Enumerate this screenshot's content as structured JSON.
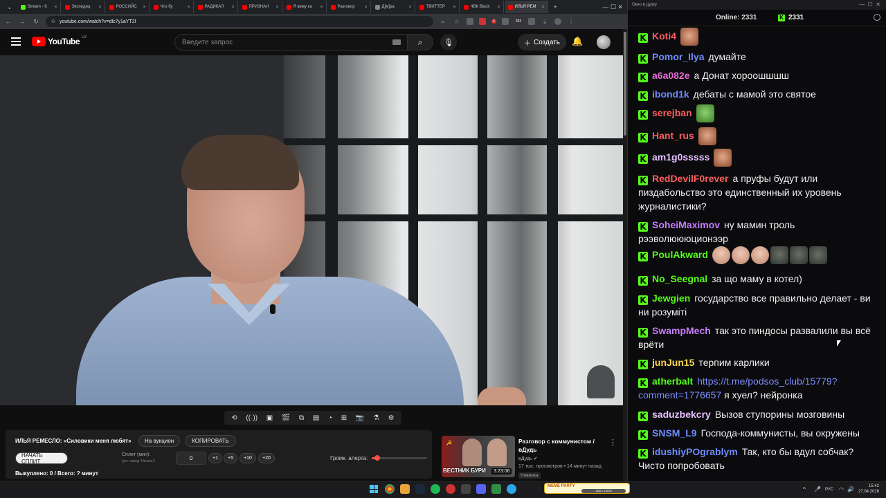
{
  "browser": {
    "tabs": [
      {
        "label": "Stream - K",
        "icon": "kick"
      },
      {
        "label": "Экспедиц",
        "icon": "youtube"
      },
      {
        "label": "РОССИЙС",
        "icon": "youtube"
      },
      {
        "label": "Что бу",
        "icon": "youtube"
      },
      {
        "label": "РАДИКАЛ",
        "icon": "youtube"
      },
      {
        "label": "ПРИЗНАН",
        "icon": "youtube"
      },
      {
        "label": "Я живу ка",
        "icon": "youtube"
      },
      {
        "label": "Разговор",
        "icon": "youtube"
      },
      {
        "label": "Д[м]ра",
        "icon": "generic"
      },
      {
        "label": "ТВИТТЕР",
        "icon": "youtube"
      },
      {
        "label": "ЧВК Black",
        "icon": "youtube"
      },
      {
        "label": "ИЛЬЯ РЕМ",
        "icon": "youtube",
        "active": true
      }
    ],
    "new_tab": "+",
    "url": "youtube.com/watch?v=dlc7y1aYT2I",
    "extension_badge_1": "2",
    "extension_badge_2": "283"
  },
  "youtube": {
    "logo_text": "YouTube",
    "country": "LV",
    "search_placeholder": "Введите запрос",
    "create_label": "Создать"
  },
  "video": {
    "watermark": "осторожно"
  },
  "auction": {
    "title": "ИЛЬЯ РЕМЕСЛО: «Силовики меня любят»",
    "auction_btn": "На аукцион",
    "copy_btn": "КОПИРОВАТЬ",
    "start_split_btn": "НАЧАТЬ СПЛИТ",
    "split_label": "Сплит (мин):",
    "split_note": "(уст. перед \"Начать\")",
    "split_value": "0",
    "steps": [
      "+1",
      "+5",
      "+10",
      "+20"
    ],
    "volume_label": "Громк. алерта:",
    "volume_level": 0.1,
    "status": "Выкуплено: 0 / Всего: ? минут"
  },
  "related": {
    "thumb_text": "ВЕСТНИК БУРИ",
    "duration": "3:23:06",
    "title": "Разговор с коммунистом / вДудь",
    "channel": "вДудь",
    "meta": "17 тыс. просмотров • 14 минут назад",
    "badge": "Новинка"
  },
  "chat": {
    "window_title": "Окно в дурку",
    "online_label": "Online: 2331",
    "kick_count": "2331",
    "messages": [
      {
        "user": "Koti4",
        "color": "#ff5f5f",
        "text": "",
        "emotes": [
          "face"
        ]
      },
      {
        "user": "Pomor_Ilya",
        "color": "#6f8cff",
        "text": "думайте"
      },
      {
        "user": "a6a082e",
        "color": "#e36ed8",
        "text": "а Донат хороошшшш"
      },
      {
        "user": "ibond1k",
        "color": "#6f8cff",
        "text": "дебаты с мамой это святое"
      },
      {
        "user": "serejban",
        "color": "#ff5f5f",
        "text": "",
        "emotes": [
          "pepe"
        ]
      },
      {
        "user": "Hant_rus",
        "color": "#ff5f5f",
        "text": "",
        "emotes": [
          "face"
        ]
      },
      {
        "user": "am1g0sssss",
        "color": "#e5c0ff",
        "text": "",
        "emotes": [
          "face"
        ]
      },
      {
        "user": "RedDevilF0rever",
        "color": "#ff5f5f",
        "text": "а пруфы будут или пиздабольство это единственный их уровень журналистики?"
      },
      {
        "user": "SoheiMaximov",
        "color": "#c77dff",
        "text": "ну мамин троль рээволюююционээр"
      },
      {
        "user": "PoulAkward",
        "color": "#53fc18",
        "text": "",
        "emotes": [
          "bald",
          "bald",
          "bald",
          "dark",
          "dark",
          "dark"
        ]
      },
      {
        "user": "No_Seegnal",
        "color": "#53fc18",
        "text": "за що маму в котел)"
      },
      {
        "user": "Jewgien",
        "color": "#53fc18",
        "text": "государство все правильно делает - ви ни розуміті"
      },
      {
        "user": "SwampMech",
        "color": "#c77dff",
        "text": "так это пиндосы развалили вы всё врёти"
      },
      {
        "user": "junJun15",
        "color": "#ffd84d",
        "text": "терпим карлики"
      },
      {
        "user": "atherbalt",
        "color": "#53fc18",
        "text": "я хуел? нейронка",
        "link": "https://t.me/podsos_club/15779?comment=1776657"
      },
      {
        "user": "saduzbekcry",
        "color": "#e5c0ff",
        "text": "Вызов ступорины мозговины"
      },
      {
        "user": "SNSM_L9",
        "color": "#6f8cff",
        "text": "Господа-коммунисты, вы окружены"
      },
      {
        "user": "idushiyPOgrablym",
        "color": "#6f8cff",
        "text": "Так, кто бы вдул собчак? Чисто попробовать"
      }
    ]
  },
  "taskbar": {
    "meme_title": "MEME PARTY",
    "meme_progress": "1850 / 15000",
    "lang": "РУС",
    "time": "15:42",
    "date": "27.04.2026"
  }
}
